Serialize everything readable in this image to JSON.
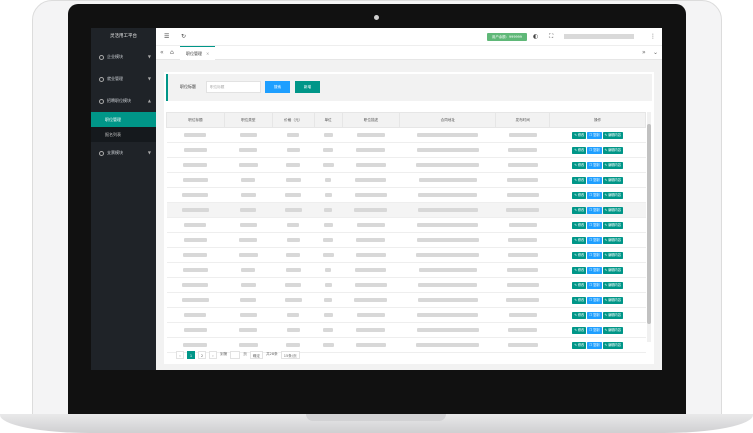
{
  "sidebar": {
    "title": "灵活用工平台",
    "groups": [
      {
        "label": "企业模块"
      },
      {
        "label": "就业管理"
      },
      {
        "label": "招聘职位模块"
      },
      {
        "label": "支票模块"
      }
    ],
    "sub_items": [
      {
        "label": "职位管理"
      },
      {
        "label": "报名列表"
      }
    ]
  },
  "topbar": {
    "badge": "用户余额：999999",
    "menu_icon": "hamburger-icon",
    "refresh_icon": "refresh-icon"
  },
  "tabs": [
    {
      "label": "职位管理"
    }
  ],
  "search": {
    "label": "职位标题",
    "placeholder": "职位标题",
    "search_label": "搜索",
    "add_label": "新增"
  },
  "table": {
    "headers": [
      "职位标题",
      "职位类型",
      "价格（元）",
      "单位",
      "职位描述",
      "合同地址",
      "发布时间",
      "操作"
    ],
    "row_count": 15,
    "highlight_row": 5,
    "actions": {
      "edit": "修改",
      "copy": "复制",
      "candidates": "编辑内容"
    }
  },
  "pager": {
    "pages": [
      "1",
      "2"
    ],
    "goto_prefix": "到第",
    "goto_suffix": "页",
    "confirm": "确定",
    "total": "共28条",
    "page_size": "15条/页"
  },
  "colors": {
    "accent": "#009688",
    "primary": "#1e9fff",
    "sidebar": "#1f2328"
  }
}
